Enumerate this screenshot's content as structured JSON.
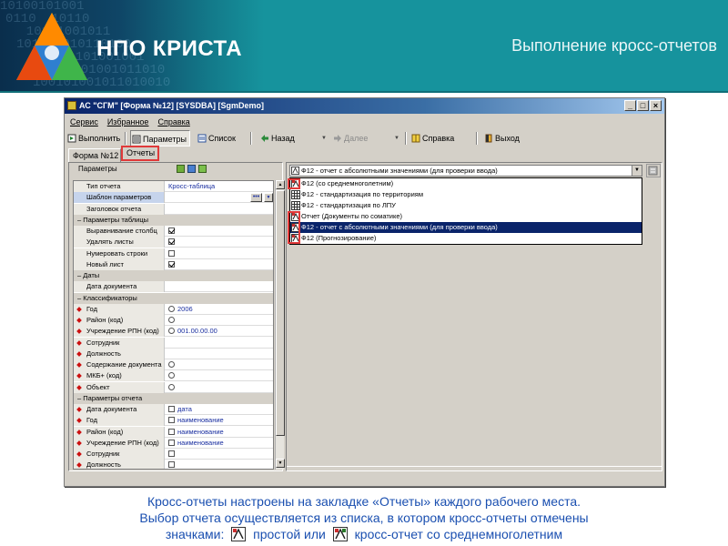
{
  "header": {
    "logo_text": "НПО КРИСТА",
    "slide_title": "Выполнение кросс-отчетов",
    "binary_rows": [
      "10100101001",
      "0110  10110",
      "  10101001011",
      "10110 010110100",
      "   0101101001001",
      "011010101001011010",
      "100101001011010010"
    ]
  },
  "window": {
    "title": "АС \"СГМ\" [Форма №12] [SYSDBA] [SgmDemo]",
    "controls": [
      "_",
      "□",
      "×"
    ],
    "menu": [
      "Сервис",
      "Избранное",
      "Справка"
    ],
    "toolbar": {
      "run": "Выполнить",
      "params": "Параметры",
      "list": "Список",
      "back": "Назад",
      "next": "Далее",
      "help": "Справка",
      "exit": "Выход"
    },
    "tabs": {
      "form": "Форма №12",
      "reports": "Отчеты"
    }
  },
  "left_panel": {
    "header": "Параметры",
    "rows": [
      {
        "key": "Тип отчета",
        "value": "Кросс-таблица"
      },
      {
        "key": "Шаблон параметров",
        "value": ""
      },
      {
        "key": "Заголовок отчета",
        "value": ""
      },
      {
        "key": "Параметры таблицы",
        "value": ""
      },
      {
        "key": "Выравнивание столбц",
        "value": ""
      },
      {
        "key": "Удалять листы",
        "value": ""
      },
      {
        "key": "Нумеровать строки",
        "value": ""
      },
      {
        "key": "Новый лист",
        "value": ""
      },
      {
        "key": "Даты",
        "value": ""
      },
      {
        "key": "Дата документа",
        "value": ""
      },
      {
        "key": "Классификаторы",
        "value": ""
      },
      {
        "key": "Год",
        "value": "2006"
      },
      {
        "key": "Район (код)",
        "value": ""
      },
      {
        "key": "Учреждение РПН (код)",
        "value": "001.00.00.00"
      },
      {
        "key": "Сотрудник",
        "value": ""
      },
      {
        "key": "Должность",
        "value": ""
      },
      {
        "key": "Содержание документа",
        "value": ""
      },
      {
        "key": "МКБ+ (код)",
        "value": ""
      },
      {
        "key": "Объект",
        "value": ""
      },
      {
        "key": "Параметры отчета",
        "value": ""
      },
      {
        "key": "Дата документа",
        "value": "дата"
      },
      {
        "key": "Год",
        "value": "наименование"
      },
      {
        "key": "Район (код)",
        "value": "наименование"
      },
      {
        "key": "Учреждение РПН (код)",
        "value": "наименование"
      },
      {
        "key": "Сотрудник",
        "value": ""
      },
      {
        "key": "Должность",
        "value": ""
      }
    ]
  },
  "right_panel": {
    "combo_value": "Ф12 - отчет с абсолютными значениями (для проверки ввода)",
    "options": [
      "Ф12 (со среднемноголетним)",
      "Ф12 - стандартизация по территориям",
      "Ф12 - стандартизация по ЛПУ",
      "Отчет (Документы по соматике)",
      "Ф12 - отчет с абсолютными значениями (для проверки ввода)",
      "Ф12 (Прогнозирование)"
    ],
    "selected_index": 4
  },
  "caption": {
    "line1": "Кросс-отчеты настроены на закладке «Отчеты» каждого рабочего места.",
    "line2": "Выбор отчета осуществляется из списка, в котором кросс-отчеты отмечены",
    "line3_a": "значками:",
    "line3_b": "простой или",
    "line3_c": "кросс-отчет со среднемноголетним"
  },
  "colors": {
    "header_bg": "#16939d",
    "highlight_red": "#e03a3a",
    "caption_text": "#1a4fb0",
    "selection": "#0a246a"
  }
}
